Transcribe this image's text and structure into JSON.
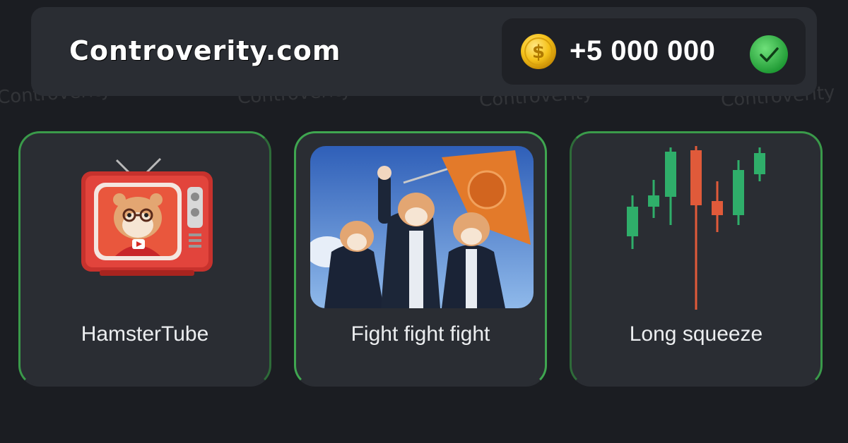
{
  "header": {
    "brand": "Controverity.com",
    "reward_amount": "+5 000 000",
    "coin_icon": "gold-dollar-coin-icon",
    "check_icon": "green-checkmark-icon"
  },
  "watermark": "Controverity",
  "cards": [
    {
      "label": "HamsterTube",
      "icon": "hamster-tv-icon"
    },
    {
      "label": "Fight fight fight",
      "icon": "hamsters-with-flag-image"
    },
    {
      "label": "Long squeeze",
      "icon": "candlestick-chart-icon"
    }
  ],
  "colors": {
    "background": "#1b1d22",
    "panel": "#2a2d33",
    "card_border": "#3fa650",
    "candle_green": "#2fae6a",
    "candle_red": "#e05a3a"
  }
}
